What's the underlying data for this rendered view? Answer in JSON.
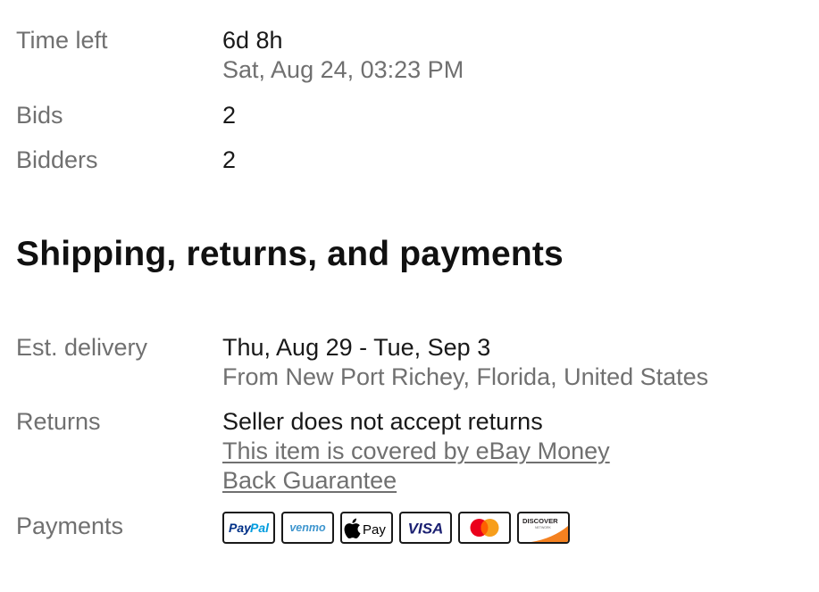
{
  "time_left": {
    "label": "Time left",
    "value": "6d 8h",
    "end": "Sat, Aug 24, 03:23 PM"
  },
  "bids": {
    "label": "Bids",
    "value": "2"
  },
  "bidders": {
    "label": "Bidders",
    "value": "2"
  },
  "section_title": "Shipping, returns, and payments",
  "delivery": {
    "label": "Est. delivery",
    "value": "Thu, Aug 29 - Tue, Sep 3",
    "origin": "From New Port Richey, Florida, United States"
  },
  "returns": {
    "label": "Returns",
    "value": "Seller does not accept returns",
    "guarantee_link": "This item is covered by eBay Money Back Guarantee"
  },
  "payments": {
    "label": "Payments",
    "methods": [
      "PayPal",
      "Venmo",
      "Apple Pay",
      "Visa",
      "Mastercard",
      "Discover"
    ],
    "icons": [
      "paypal-icon",
      "venmo-icon",
      "apple-pay-icon",
      "visa-icon",
      "mastercard-icon",
      "discover-icon"
    ],
    "icon_text": {
      "paypal_pay": "Pay",
      "paypal_pal": "Pal",
      "venmo": "venmo",
      "apple_pay": "Pay",
      "visa": "VISA",
      "discover": "DISCOVER",
      "discover_sub": "NETWORK"
    }
  },
  "colors": {
    "label": "#707070",
    "text": "#191919",
    "paypal_dark": "#003087",
    "paypal_light": "#009cde",
    "venmo": "#3d95ce",
    "visa": "#1a1f71",
    "mastercard_red": "#eb001b",
    "mastercard_yellow": "#f79e1b",
    "discover_orange": "#f48120"
  }
}
